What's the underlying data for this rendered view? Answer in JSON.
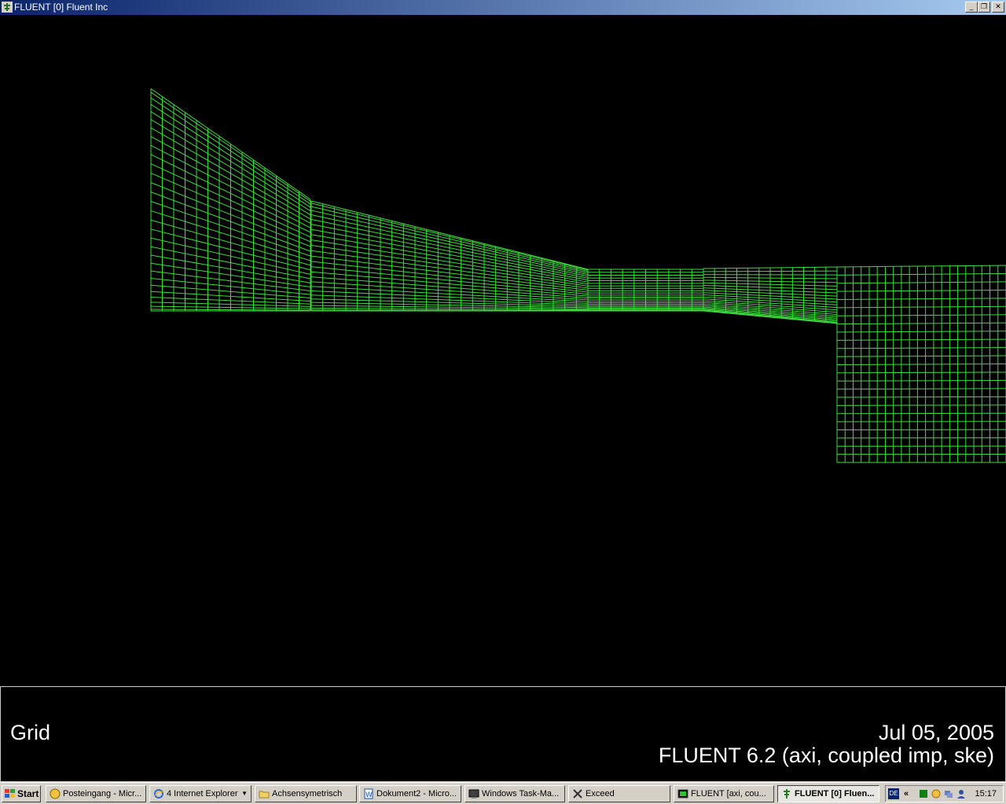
{
  "window": {
    "title": "FLUENT [0] Fluent Inc",
    "buttons": {
      "minimize": "_",
      "restore": "❐",
      "close": "✕"
    }
  },
  "caption": {
    "label": "Grid",
    "date": "Jul 05, 2005",
    "version": "FLUENT 6.2 (axi, coupled imp, ske)"
  },
  "colors": {
    "mesh": "#3ddc3d",
    "background": "#000000",
    "titlebar": "#0a246a"
  },
  "taskbar": {
    "start_label": "Start",
    "tasks": [
      {
        "label": "Posteingang - Micr...",
        "icon": "outlook-icon"
      },
      {
        "label": "4 Internet Explorer",
        "icon": "internet-explorer-icon"
      },
      {
        "label": "Achsensymetrisch",
        "icon": "folder-icon"
      },
      {
        "label": "Dokument2 - Micro...",
        "icon": "word-icon"
      },
      {
        "label": "Windows Task-Ma...",
        "icon": "task-manager-icon"
      },
      {
        "label": "Exceed",
        "icon": "exceed-icon"
      },
      {
        "label": "FLUENT  [axi, cou...",
        "icon": "fluent-console-icon"
      },
      {
        "label": "FLUENT [0] Fluen...",
        "icon": "fluent-icon",
        "active": true
      }
    ],
    "tray": {
      "language": "DE",
      "expand": "«",
      "clock": "15:17"
    }
  }
}
